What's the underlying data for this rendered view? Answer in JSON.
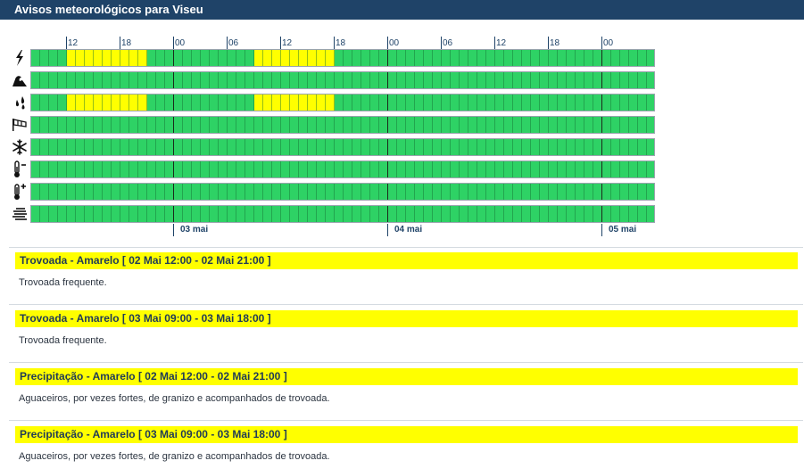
{
  "window": {
    "title": "Avisos meteorológicos para Viseu"
  },
  "timeline": {
    "hour_labels": [
      "12",
      "18",
      "00",
      "06",
      "12",
      "18",
      "00",
      "06",
      "12",
      "18",
      "00"
    ],
    "day_labels": [
      "03 mai",
      "04 mai",
      "05 mai"
    ],
    "colors": {
      "green": "#2ed265",
      "yellow": "#ffff00"
    },
    "rows": [
      {
        "name": "trovoada",
        "icon": "lightning-icon",
        "level": [
          "green",
          "yellow",
          "green",
          "yellow",
          "green",
          "green",
          "green",
          "green"
        ]
      },
      {
        "name": "agitacao-maritima",
        "icon": "wave-icon",
        "level": [
          "green",
          "green",
          "green",
          "green",
          "green",
          "green",
          "green",
          "green"
        ]
      },
      {
        "name": "precipitacao",
        "icon": "rain-icon",
        "level": [
          "green",
          "yellow",
          "green",
          "yellow",
          "green",
          "green",
          "green",
          "green"
        ]
      },
      {
        "name": "vento",
        "icon": "wind-icon",
        "level": [
          "green",
          "green",
          "green",
          "green",
          "green",
          "green",
          "green",
          "green"
        ]
      },
      {
        "name": "neve",
        "icon": "snowflake-icon",
        "level": [
          "green",
          "green",
          "green",
          "green",
          "green",
          "green",
          "green",
          "green"
        ]
      },
      {
        "name": "tempo-frio",
        "icon": "thermometer-cold-icon",
        "level": [
          "green",
          "green",
          "green",
          "green",
          "green",
          "green",
          "green",
          "green"
        ]
      },
      {
        "name": "tempo-quente",
        "icon": "thermometer-hot-icon",
        "level": [
          "green",
          "green",
          "green",
          "green",
          "green",
          "green",
          "green",
          "green"
        ]
      },
      {
        "name": "nevoeiro",
        "icon": "fog-icon",
        "level": [
          "green",
          "green",
          "green",
          "green",
          "green",
          "green",
          "green",
          "green"
        ]
      }
    ]
  },
  "warnings": [
    {
      "header": "Trovoada - Amarelo [ 02 Mai 12:00 - 02 Mai 21:00 ]",
      "description": "Trovoada frequente."
    },
    {
      "header": "Trovoada - Amarelo [ 03 Mai 09:00 - 03 Mai 18:00 ]",
      "description": "Trovoada frequente."
    },
    {
      "header": "Precipitação - Amarelo [ 02 Mai 12:00 - 02 Mai 21:00 ]",
      "description": "Aguaceiros, por vezes fortes, de granizo e acompanhados de trovoada."
    },
    {
      "header": "Precipitação - Amarelo [ 03 Mai 09:00 - 03 Mai 18:00 ]",
      "description": "Aguaceiros, por vezes fortes, de granizo e acompanhados de trovoada."
    }
  ]
}
